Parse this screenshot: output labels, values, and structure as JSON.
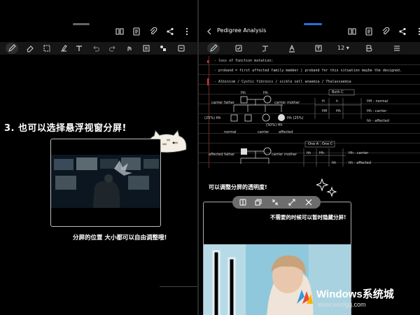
{
  "left": {
    "caption_top": "3. 也可以选择悬浮视窗分屏!",
    "caption_bottom": "分屏的位置 大小都可以自由调整哦!"
  },
  "right": {
    "title": "Pedigree Analysis",
    "font_size": "12",
    "notes": {
      "line1": "- loss of function mutation:",
      "line2": "- proband = first affected family member | proband for this situation maybe the designed.",
      "line3": "- Albinism / Cystic fibrosis / sickle cell anaemia / Thalassaemia",
      "box1": "Both C",
      "carrier_father": "carrier father",
      "carrier_mother": "carrier mother",
      "normal": "normal",
      "carrier": "carrier",
      "affected": "affected",
      "pct1": "(25%) Hh",
      "pct2": "(50%) Hh",
      "pct3": "Hh (25%)",
      "hh": "Hh",
      "hh2": "hh",
      "HH": "HH",
      "t_normal": "HH - normal",
      "t_carrier": "Hh - carrier",
      "t_affected": "hh - affected",
      "box2": "One A , One C",
      "affected_father": "affected father",
      "carrier_mother2": "carrier mother",
      "t2_carrier": "Hh - carrier",
      "t2_affected": "hh - affected",
      "h1": "H",
      "h2": "h"
    },
    "caption_top": "可以调整分屏的透明度!",
    "caption_bottom": "不需要的时候可以暂时隐藏分屏!"
  },
  "watermark": {
    "title": "Windows系统城",
    "url": "www.wxclgg.com"
  },
  "colors": {
    "background": "#000000",
    "toolbar": "#161616",
    "accent_blue": "#2f6dd8",
    "float_toolbar": "#6d6d6d"
  },
  "icons": {
    "left_top": [
      "book-icon",
      "document-icon",
      "attachment-icon",
      "share-icon",
      "more-icon"
    ],
    "right_top": [
      "book-icon",
      "document-icon",
      "attachment-icon",
      "share-icon",
      "more-icon"
    ],
    "float_toolbar": [
      "opacity-icon",
      "switch-icon",
      "minimize-icon",
      "expand-icon",
      "close-icon"
    ]
  }
}
